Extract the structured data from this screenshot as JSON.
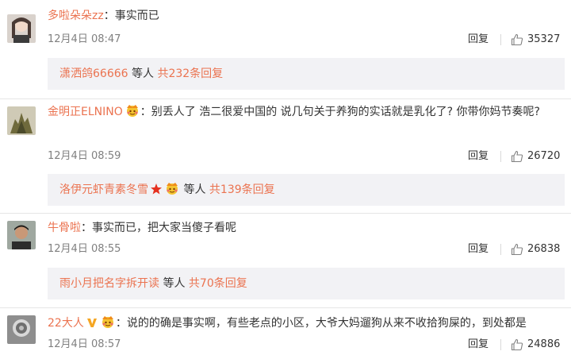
{
  "comments": [
    {
      "username": "多啦朵朵zz",
      "separator": "：",
      "text": "事实而已",
      "time": "12月4日 08:47",
      "reply_label": "回复",
      "likes": "35327",
      "sub": {
        "names": "潇洒鸽66666",
        "etc": " 等人 ",
        "count": "共232条回复"
      }
    },
    {
      "username": "金明正ELNINO",
      "separator": "：",
      "text": "别丢人了 浩二很爱中国的 说几句关于养狗的实话就是乳化了? 你带你妈节奏呢?",
      "time": "12月4日 08:59",
      "reply_label": "回复",
      "likes": "26720",
      "sub": {
        "names": "洛伊元虾青素冬雪",
        "etc": " 等人 ",
        "count": "共139条回复"
      }
    },
    {
      "username": "牛骨啦",
      "separator": "：",
      "text": "事实而已，把大家当傻子看呢",
      "time": "12月4日 08:55",
      "reply_label": "回复",
      "likes": "26838",
      "sub": {
        "names": "雨小月把名字拆开读",
        "etc": " 等人 ",
        "count": "共70条回复"
      }
    },
    {
      "username": "22大人",
      "separator": "：",
      "text": "说的的确是事实啊，有些老点的小区，大爷大妈遛狗从来不收拾狗屎的，到处都是",
      "time": "12月4日 08:57",
      "reply_label": "回复",
      "likes": "24886"
    }
  ],
  "colors": {
    "username": "#eb7350",
    "meta": "#808080",
    "subbox_bg": "#f2f2f5"
  },
  "icons": {
    "like": "thumbs-up-icon",
    "member": "crown-face-icon",
    "verified": "v-icon",
    "fan": "red-star-icon"
  }
}
